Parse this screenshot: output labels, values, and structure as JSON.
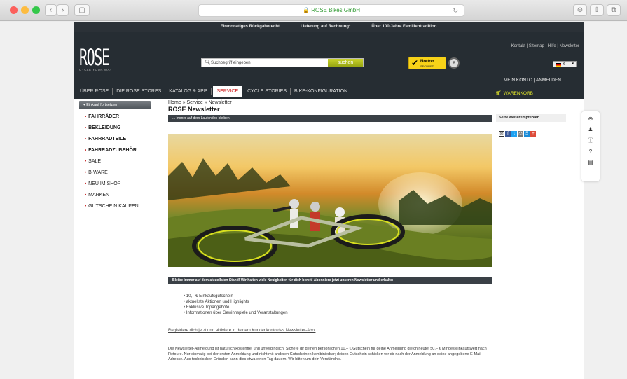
{
  "browser": {
    "url_text": "ROSE Bikes GmbH",
    "nav_back": "‹",
    "nav_forward": "›",
    "reload": "↻"
  },
  "topbar": [
    "Einmonatiges Rückgaberecht",
    "Lieferung auf Rechnung*",
    "Über 100 Jahre Familientradition"
  ],
  "header": {
    "logo": "ROSE",
    "tagline": "CYCLE YOUR WAY",
    "search_placeholder": "Suchbegriff eingeben",
    "search_button": "suchen",
    "norton_title": "Norton",
    "norton_sub": "SECURED",
    "meta_links": "Kontakt | Sitemap | Hilfe | Newsletter",
    "lang_label": "€",
    "account_links": "MEIN KONTO | ANMELDEN",
    "cart_label": "WARENKORB"
  },
  "main_nav": [
    "ÜBER ROSE",
    "DIE ROSE STORES",
    "KATALOG & APP",
    "SERVICE",
    "CYCLE STORIES",
    "BIKE-KONFIGURATION"
  ],
  "left_nav": {
    "button": "Einkauf fortsetzen",
    "bold_items": [
      "FAHRRÄDER",
      "BEKLEIDUNG",
      "FAHRRADTEILE",
      "FAHRRADZUBEHÖR"
    ],
    "normal_items": [
      "SALE",
      "B-WARE",
      "NEU IM SHOP",
      "MARKEN",
      "GUTSCHEIN KAUFEN"
    ]
  },
  "content": {
    "breadcrumb": "Home » Service » Newsletter",
    "title": "ROSE Newsletter",
    "subbar": "... Immer auf dem Laufenden bleiben!",
    "infobar": "Bleibe immer auf dem aktuellsten Stand! Wir halten viele Neuigkeiten für dich bereit! Abonniere jetzt unseren Newsletter und erhalte:",
    "benefits": [
      "10,– € Einkaufsgutschein",
      "aktuellste Aktionen und Highlights",
      "Exklusive Topangebote",
      "Informationen über Gewinnspiele und Veranstaltungen"
    ],
    "register_link": "Registriere dich jetzt und aktiviere in deinem Kundenkonto das Newsletter-Abo!",
    "paragraph": "Die Newsletter-Anmeldung ist natürlich kostenfrei und unverbindlich. Sichere dir deinen persönlichen 10,– € Gutschein für deine Anmeldung gleich heute! 50,– € Mindesteinkaufswert nach Retoure. Nur einmalig bei der ersten Anmeldung und nicht mit anderen Gutscheinen kombinierbar; deinen Gutschein schicken wir dir nach der Anmeldung an deine angegebene E-Mail Adresse. Aus technischen Gründen kann dies etwa einen Tag dauern. Wir bitten um dein Verständnis."
  },
  "sidebar": {
    "heading": "Seite weiterempfehlen"
  },
  "colors": {
    "dark": "#262d33",
    "accent_green": "#c8d22a",
    "active_red": "#c11111"
  }
}
